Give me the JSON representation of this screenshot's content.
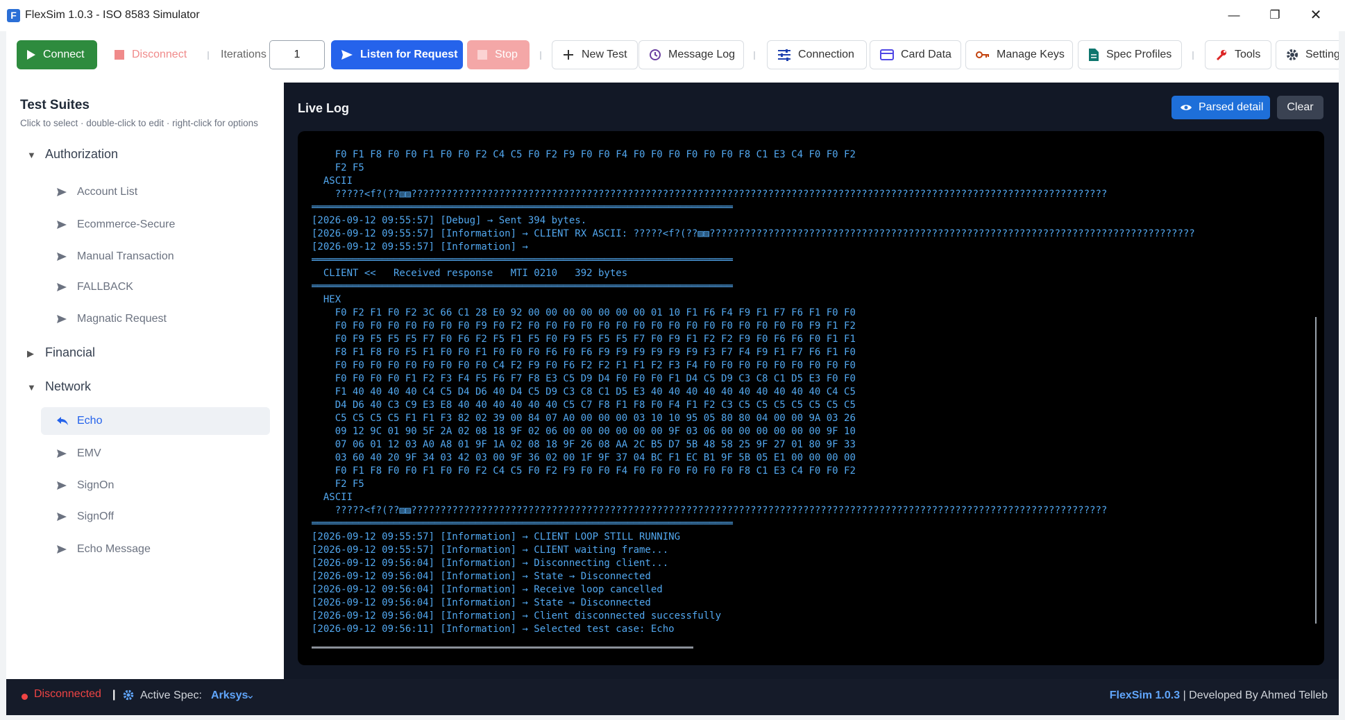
{
  "window": {
    "title": "FlexSim 1.0.3 - ISO 8583 Simulator",
    "app_icon_letter": "F",
    "min_glyph": "—",
    "max_glyph": "❐",
    "close_glyph": "✕"
  },
  "toolbar": {
    "connect": "Connect",
    "disconnect": "Disconnect",
    "iterations_label": "Iterations",
    "iterations_value": "1",
    "listen": "Listen for Request",
    "stop": "Stop",
    "new_test": "New Test",
    "message_log": "Message Log",
    "connection": "Connection",
    "card_data": "Card Data",
    "manage_keys": "Manage Keys",
    "spec_profiles": "Spec Profiles",
    "tools": "Tools",
    "settings": "Settings"
  },
  "sidebar": {
    "title": "Test Suites",
    "subtitle": "Click to select · double-click to edit · right-click for options",
    "groups": [
      {
        "label": "Authorization",
        "expanded": true,
        "items": [
          "Account List",
          "Ecommerce-Secure",
          "Manual Transaction",
          "FALLBACK",
          "Magnatic Request"
        ]
      },
      {
        "label": "Financial",
        "expanded": false,
        "items": []
      },
      {
        "label": "Network",
        "expanded": true,
        "items": [
          "Echo",
          "EMV",
          "SignOn",
          "SignOff",
          "Echo Message"
        ]
      }
    ],
    "selected": "Echo"
  },
  "log": {
    "title": "Live Log",
    "parsed_button": "Parsed detail",
    "clear_button": "Clear",
    "lines": [
      "    F0 F1 F8 F0 F0 F1 F0 F0 F2 C4 C5 F0 F2 F9 F0 F0 F4 F0 F0 F0 F0 F0 F0 F8 C1 E3 C4 F0 F0 F2",
      "    F2 F5",
      "  ASCII",
      "    ?????<f?(??▨▨???????????????????????????????????????????????????????????????????????????????????????????????????????????????????????",
      "════════════════════════════════════════════════════════════════════════",
      "[2026-09-12 09:55:57] [Debug] → Sent 394 bytes.",
      "[2026-09-12 09:55:57] [Information] → CLIENT RX ASCII: ?????<f?(??▨▨???????????????????????????????????????????????????????????????????????????????????",
      "[2026-09-12 09:55:57] [Information] →",
      "════════════════════════════════════════════════════════════════════════",
      "  CLIENT <<   Received response   MTI 0210   392 bytes",
      "════════════════════════════════════════════════════════════════════════",
      "  HEX",
      "    F0 F2 F1 F0 F2 3C 66 C1 28 E0 92 00 00 00 00 00 00 00 01 10 F1 F6 F4 F9 F1 F7 F6 F1 F0 F0",
      "    F0 F0 F0 F0 F0 F0 F0 F0 F9 F0 F2 F0 F0 F0 F0 F0 F0 F0 F0 F0 F0 F0 F0 F0 F0 F0 F0 F9 F1 F2",
      "    F0 F9 F5 F5 F5 F7 F0 F6 F2 F5 F1 F5 F0 F9 F5 F5 F5 F7 F0 F9 F1 F2 F2 F9 F0 F6 F6 F0 F1 F1",
      "    F8 F1 F8 F0 F5 F1 F0 F0 F1 F0 F0 F0 F6 F0 F6 F9 F9 F9 F9 F9 F9 F3 F7 F4 F9 F1 F7 F6 F1 F0",
      "    F0 F0 F0 F0 F0 F0 F0 F0 F0 C4 F2 F9 F0 F6 F2 F2 F1 F1 F2 F3 F4 F0 F0 F0 F0 F0 F0 F0 F0 F0",
      "    F0 F0 F0 F0 F1 F2 F3 F4 F5 F6 F7 F8 E3 C5 D9 D4 F0 F0 F0 F1 D4 C5 D9 C3 C8 C1 D5 E3 F0 F0",
      "    F1 40 40 40 40 C4 C5 D4 D6 40 D4 C5 D9 C3 C8 C1 D5 E3 40 40 40 40 40 40 40 40 40 40 C4 C5",
      "    D4 D6 40 C3 C9 E3 E8 40 40 40 40 40 40 C5 C7 F8 F1 F8 F0 F4 F1 F2 C3 C5 C5 C5 C5 C5 C5 C5",
      "    C5 C5 C5 C5 F1 F1 F3 82 02 39 00 84 07 A0 00 00 00 03 10 10 95 05 80 80 04 00 00 9A 03 26",
      "    09 12 9C 01 90 5F 2A 02 08 18 9F 02 06 00 00 00 00 00 00 9F 03 06 00 00 00 00 00 00 9F 10",
      "    07 06 01 12 03 A0 A8 01 9F 1A 02 08 18 9F 26 08 AA 2C B5 D7 5B 48 58 25 9F 27 01 80 9F 33",
      "    03 60 40 20 9F 34 03 42 03 00 9F 36 02 00 1F 9F 37 04 BC F1 EC B1 9F 5B 05 E1 00 00 00 00",
      "    F0 F1 F8 F0 F0 F1 F0 F0 F2 C4 C5 F0 F2 F9 F0 F0 F4 F0 F0 F0 F0 F0 F0 F8 C1 E3 C4 F0 F0 F2",
      "    F2 F5",
      "  ASCII",
      "    ?????<f?(??▨▨???????????????????????????????????????????????????????????????????????????????????????????????????????????????????????",
      "════════════════════════════════════════════════════════════════════════",
      "[2026-09-12 09:55:57] [Information] → CLIENT LOOP STILL RUNNING",
      "[2026-09-12 09:55:57] [Information] → CLIENT waiting frame...",
      "[2026-09-12 09:56:04] [Information] → Disconnecting client...",
      "[2026-09-12 09:56:04] [Information] → State → Disconnected",
      "[2026-09-12 09:56:04] [Information] → Receive loop cancelled",
      "[2026-09-12 09:56:04] [Information] → State → Disconnected",
      "[2026-09-12 09:56:04] [Information] → Client disconnected successfully",
      "[2026-09-12 09:56:11] [Information] → Selected test case: Echo"
    ]
  },
  "status": {
    "connection": "Disconnected",
    "pipe": "|",
    "active_spec_label": "Active Spec:",
    "active_spec_value": "Arksys",
    "chevron": "⌄",
    "version": "FlexSim 1.0.3",
    "credit": "|  Developed By Ahmed Telleb"
  },
  "colors": {
    "connect_green": "#2e8b3e",
    "listen_blue": "#2563eb",
    "stop_pink": "#f4a7a7",
    "disconnect_red": "#ef4444",
    "log_text": "#52a8f0",
    "panel_dark": "#121826"
  }
}
